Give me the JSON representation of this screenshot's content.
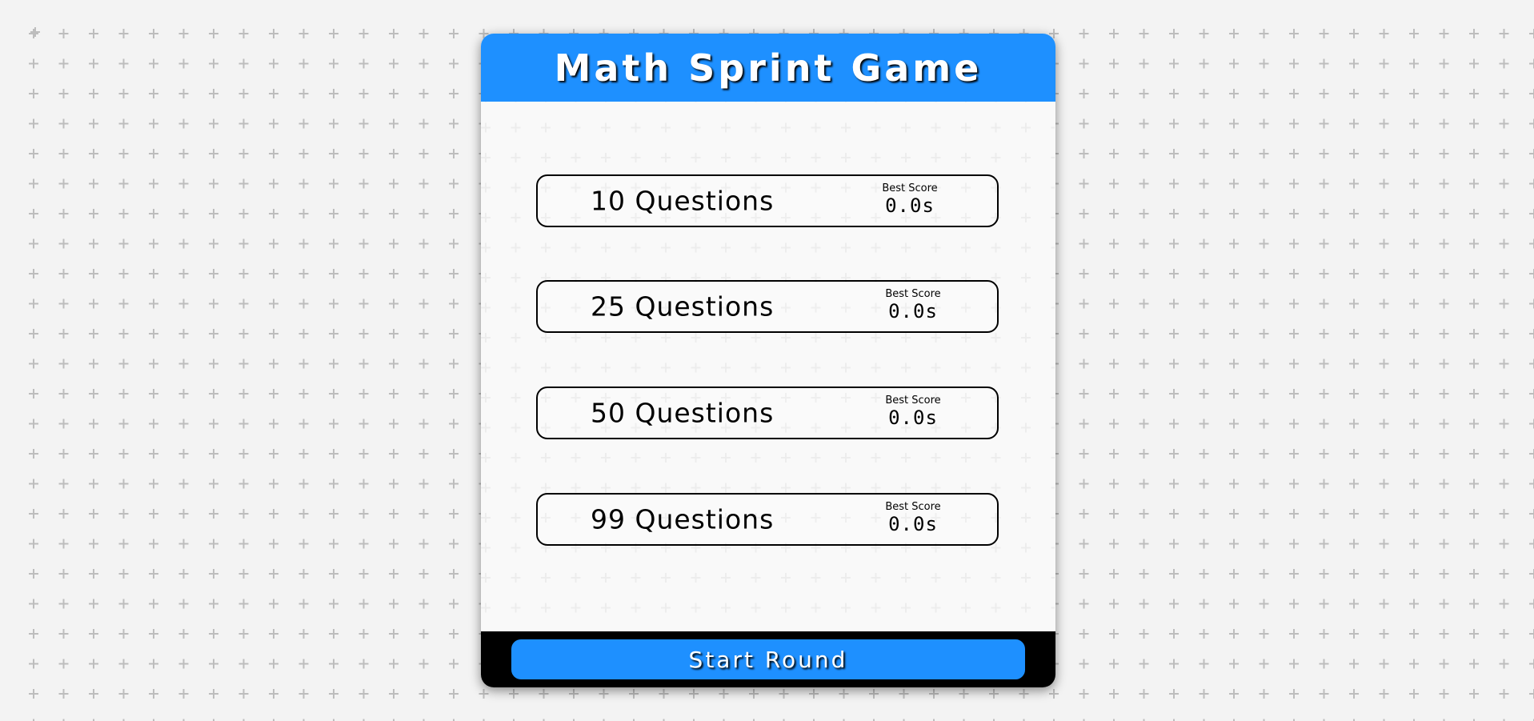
{
  "app": {
    "title": "Math Sprint Game"
  },
  "colors": {
    "accent": "#1e90ff",
    "footer": "#000000",
    "card": "#f9f9f9",
    "background": "#f3f3f3",
    "pattern": "#bdbdbd"
  },
  "choices": [
    {
      "label": "10 Questions",
      "score_caption": "Best Score",
      "score_value": "0.0s"
    },
    {
      "label": "25 Questions",
      "score_caption": "Best Score",
      "score_value": "0.0s"
    },
    {
      "label": "50 Questions",
      "score_caption": "Best Score",
      "score_value": "0.0s"
    },
    {
      "label": "99 Questions",
      "score_caption": "Best Score",
      "score_value": "0.0s"
    }
  ],
  "footer": {
    "start_label": "Start Round"
  },
  "background": {
    "pattern_icon": "plus-icon"
  }
}
